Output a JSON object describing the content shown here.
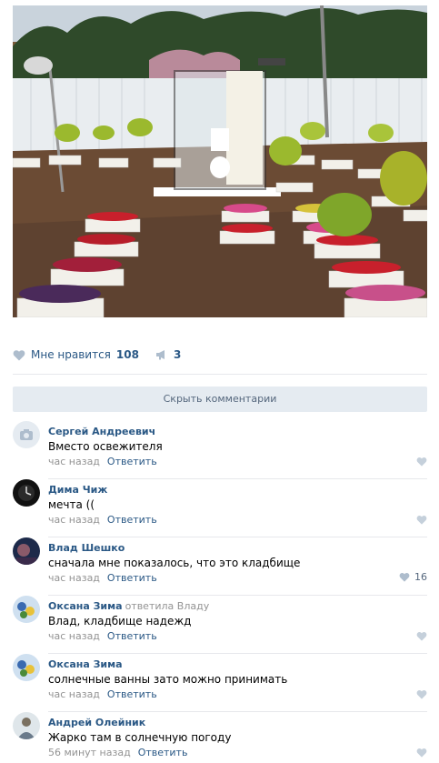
{
  "post": {
    "photo_icon": "photo-placeholder",
    "likes_label": "Мне нравится",
    "likes_count": "108",
    "shares_count": "3",
    "hide_comments_label": "Скрыть комментарии"
  },
  "colors": {
    "link": "#2a5885",
    "muted": "#939393",
    "bar": "#e5ebf1"
  },
  "comments": [
    {
      "author": "Сергей Андреевич",
      "replied_to": "",
      "text": "Вместо освежителя",
      "time": "час назад",
      "reply_label": "Ответить",
      "like_count": ""
    },
    {
      "author": "Дима Чиж",
      "replied_to": "",
      "text": "мечта ((",
      "time": "час назад",
      "reply_label": "Ответить",
      "like_count": ""
    },
    {
      "author": "Влад Шешко",
      "replied_to": "",
      "text": "сначала мне показалось, что это кладбище",
      "time": "час назад",
      "reply_label": "Ответить",
      "like_count": "16"
    },
    {
      "author": "Оксана Зима",
      "replied_to": "ответила Владу",
      "text": "Влад, кладбище надежд",
      "time": "час назад",
      "reply_label": "Ответить",
      "like_count": ""
    },
    {
      "author": "Оксана Зима",
      "replied_to": "",
      "text": "солнечные ванны зато можно принимать",
      "time": "час назад",
      "reply_label": "Ответить",
      "like_count": ""
    },
    {
      "author": "Андрей Олейник",
      "replied_to": "",
      "text": "Жарко там в солнечную погоду",
      "time": "56 минут назад",
      "reply_label": "Ответить",
      "like_count": ""
    }
  ]
}
